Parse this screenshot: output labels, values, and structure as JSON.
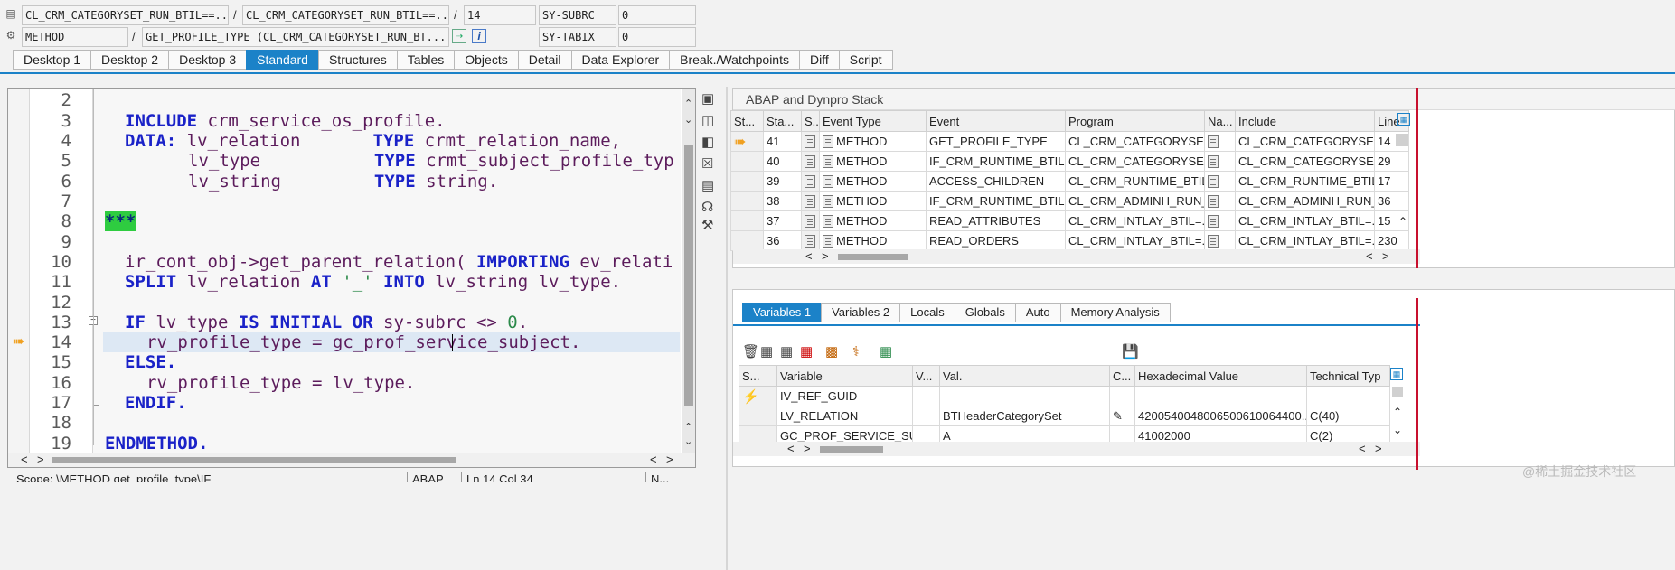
{
  "header": {
    "row1": {
      "program1": "CL_CRM_CATEGORYSET_RUN_BTIL==...",
      "sep1": "/",
      "program2": "CL_CRM_CATEGORYSET_RUN_BTIL==...",
      "sep2": "/",
      "line": "14",
      "sysvar": "SY-SUBRC",
      "sysval": "0"
    },
    "row2": {
      "type": "METHOD",
      "sep": "/",
      "event": "GET_PROFILE_TYPE (CL_CRM_CATEGORYSET_RUN_BT...",
      "sysvar": "SY-TABIX",
      "sysval": "0"
    }
  },
  "tabs": [
    "Desktop 1",
    "Desktop 2",
    "Desktop 3",
    "Standard",
    "Structures",
    "Tables",
    "Objects",
    "Detail",
    "Data Explorer",
    "Break./Watchpoints",
    "Diff",
    "Script"
  ],
  "active_tab": "Standard",
  "editor": {
    "line_numbers": [
      "2",
      "3",
      "4",
      "5",
      "6",
      "7",
      "8",
      "9",
      "10",
      "11",
      "12",
      "13",
      "14",
      "15",
      "16",
      "17",
      "18",
      "19"
    ],
    "l3_kw": "INCLUDE",
    "l3_rest": " crm_service_os_profile.",
    "l4_kw": "DATA:",
    "l4_a": " lv_relation       ",
    "l4_kw2": "TYPE",
    "l4_b": " crmt_relation_name,",
    "l5_a": "lv_type           ",
    "l5_kw": "TYPE",
    "l5_b": " crmt_subject_profile_typ",
    "l6_a": "lv_string         ",
    "l6_kw": "TYPE",
    "l6_b": " string.",
    "l8_cmt": "***",
    "l10_a": "ir_cont_obj->get_parent_relation( ",
    "l10_kw": "IMPORTING",
    "l10_b": " ev_relati",
    "l11_kw": "SPLIT",
    "l11_a": " lv_relation ",
    "l11_kw2": "AT",
    "l11_str": " '_'",
    "l11_kw3": " INTO",
    "l11_b": " lv_string lv_type.",
    "l13_kw": "IF",
    "l13_a": " lv_type ",
    "l13_kw2": "IS INITIAL OR",
    "l13_b": " sy-subrc <> ",
    "l13_num": "0",
    "l13_c": ".",
    "l14_a": "rv_profile_type = gc_prof_service_subject.",
    "l15_kw": "ELSE.",
    "l16_a": "rv_profile_type = lv_type.",
    "l17_kw": "ENDIF.",
    "l19_kw": "ENDMETHOD."
  },
  "statusbar": {
    "scope": "Scope: \\METHOD get_profile_type\\IF",
    "lang": "ABAP",
    "pos": "Ln  14 Col  34",
    "mode": "N..."
  },
  "stack": {
    "title": "ABAP and Dynpro Stack",
    "columns": [
      "St...",
      "Sta...",
      "S...",
      "Event Type",
      "Event",
      "Program",
      "Na...",
      "Include",
      "Line"
    ],
    "rows": [
      {
        "sta": "41",
        "type": "METHOD",
        "event": "GET_PROFILE_TYPE",
        "program": "CL_CRM_CATEGORYSET...",
        "include": "CL_CRM_CATEGORYSET...",
        "line": "14"
      },
      {
        "sta": "40",
        "type": "METHOD",
        "event": "IF_CRM_RUNTIME_BTIL...",
        "program": "CL_CRM_CATEGORYSET...",
        "include": "CL_CRM_CATEGORYSET...",
        "line": "29"
      },
      {
        "sta": "39",
        "type": "METHOD",
        "event": "ACCESS_CHILDREN",
        "program": "CL_CRM_RUNTIME_BTIL...",
        "include": "CL_CRM_RUNTIME_BTIL...",
        "line": "17"
      },
      {
        "sta": "38",
        "type": "METHOD",
        "event": "IF_CRM_RUNTIME_BTIL...",
        "program": "CL_CRM_ADMINH_RUN_...",
        "include": "CL_CRM_ADMINH_RUN_...",
        "line": "36"
      },
      {
        "sta": "37",
        "type": "METHOD",
        "event": "READ_ATTRIBUTES",
        "program": "CL_CRM_INTLAY_BTIL=...",
        "include": "CL_CRM_INTLAY_BTIL=...",
        "line": "15"
      },
      {
        "sta": "36",
        "type": "METHOD",
        "event": "READ_ORDERS",
        "program": "CL_CRM_INTLAY_BTIL=...",
        "include": "CL_CRM_INTLAY_BTIL=...",
        "line": "230"
      }
    ]
  },
  "vartabs": [
    "Variables 1",
    "Variables 2",
    "Locals",
    "Globals",
    "Auto",
    "Memory Analysis"
  ],
  "active_vartab": "Variables 1",
  "variables": {
    "columns": [
      "S...",
      "Variable",
      "V...",
      "Val.",
      "C...",
      "Hexadecimal Value",
      "Technical Typ"
    ],
    "rows": [
      {
        "variable": "IV_REF_GUID",
        "value": "",
        "hex": "",
        "type": ""
      },
      {
        "variable": "LV_RELATION",
        "value": "BTHeaderCategorySet",
        "hex": "4200540048006500610064400...",
        "type": "C(40)"
      },
      {
        "variable": "GC_PROF_SERVICE_SUB...",
        "value": "A",
        "hex": "41002000",
        "type": "C(2)"
      }
    ]
  },
  "watermark": "@稀土掘金技术社区"
}
